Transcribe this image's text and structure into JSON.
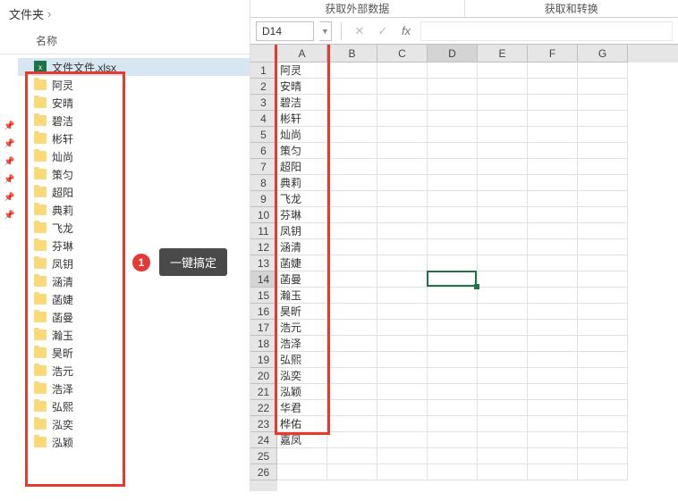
{
  "left": {
    "breadcrumb": {
      "label": "文件夹",
      "sep": "›"
    },
    "col_header": "名称",
    "xlsx_filename": "文件文件.xlsx",
    "folders": [
      "阿灵",
      "安晴",
      "碧洁",
      "彬轩",
      "灿尚",
      "策匀",
      "超阳",
      "典莉",
      "飞龙",
      "芬琳",
      "凤钥",
      "涵清",
      "菡婕",
      "菡曼",
      "瀚玉",
      "昊昕",
      "浩元",
      "浩泽",
      "弘熙",
      "泓奕",
      "泓颖"
    ],
    "callout": {
      "num": "1",
      "text": "一键搞定"
    }
  },
  "right": {
    "ribbon_groups": [
      "获取外部数据",
      "获取和转换"
    ],
    "name_box": "D14",
    "columns": [
      "A",
      "B",
      "C",
      "D",
      "E",
      "F",
      "G"
    ],
    "rows_count": 26,
    "col_a_values": [
      "阿灵",
      "安晴",
      "碧洁",
      "彬轩",
      "灿尚",
      "策匀",
      "超阳",
      "典莉",
      "飞龙",
      "芬琳",
      "凤钥",
      "涵清",
      "菡婕",
      "菡曼",
      "瀚玉",
      "昊昕",
      "浩元",
      "浩泽",
      "弘熙",
      "泓奕",
      "泓颖",
      "华君",
      "桦佑",
      "嘉凤",
      ""
    ],
    "active_cell": {
      "row": 14,
      "col": "D"
    }
  },
  "chart_data": {
    "type": "table",
    "title": "",
    "columns": [
      "A"
    ],
    "rows": [
      [
        "阿灵"
      ],
      [
        "安晴"
      ],
      [
        "碧洁"
      ],
      [
        "彬轩"
      ],
      [
        "灿尚"
      ],
      [
        "策匀"
      ],
      [
        "超阳"
      ],
      [
        "典莉"
      ],
      [
        "飞龙"
      ],
      [
        "芬琳"
      ],
      [
        "凤钥"
      ],
      [
        "涵清"
      ],
      [
        "菡婕"
      ],
      [
        "菡曼"
      ],
      [
        "瀚玉"
      ],
      [
        "昊昕"
      ],
      [
        "浩元"
      ],
      [
        "浩泽"
      ],
      [
        "弘熙"
      ],
      [
        "泓奕"
      ],
      [
        "泓颖"
      ],
      [
        "华君"
      ],
      [
        "桦佑"
      ],
      [
        "嘉凤"
      ]
    ]
  }
}
